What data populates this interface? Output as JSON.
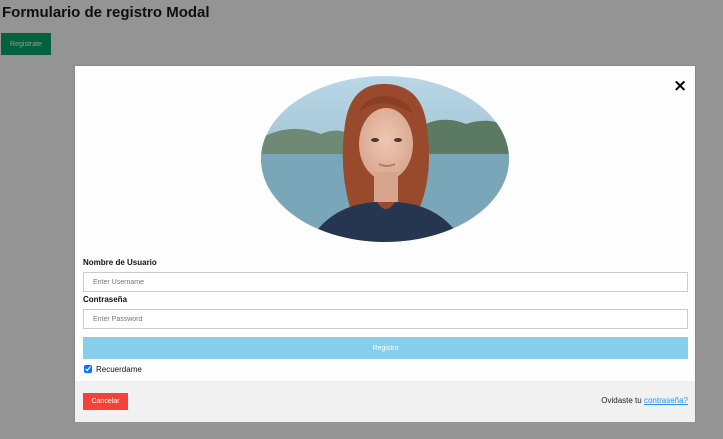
{
  "page": {
    "title": "Formulario de registro Modal"
  },
  "open_button": {
    "label": "Registrate"
  },
  "modal": {
    "close_symbol": "×",
    "username": {
      "label": "Nombre de Usuario",
      "placeholder": "Enter Username",
      "value": ""
    },
    "password": {
      "label": "Contraseña",
      "placeholder": "Enter Password",
      "value": ""
    },
    "submit_label": "Registro",
    "remember": {
      "label": "Recuerdame",
      "checked": true
    },
    "footer": {
      "cancel_label": "Cancelar",
      "forgot_prefix": "Ovidaste tu",
      "forgot_link": "contraseña?"
    }
  },
  "colors": {
    "open_button": "#04aa6d",
    "submit_button": "#87ceeb",
    "cancel_button": "#f44336",
    "link": "#2196f3",
    "footer_bg": "#f1f1f1"
  }
}
